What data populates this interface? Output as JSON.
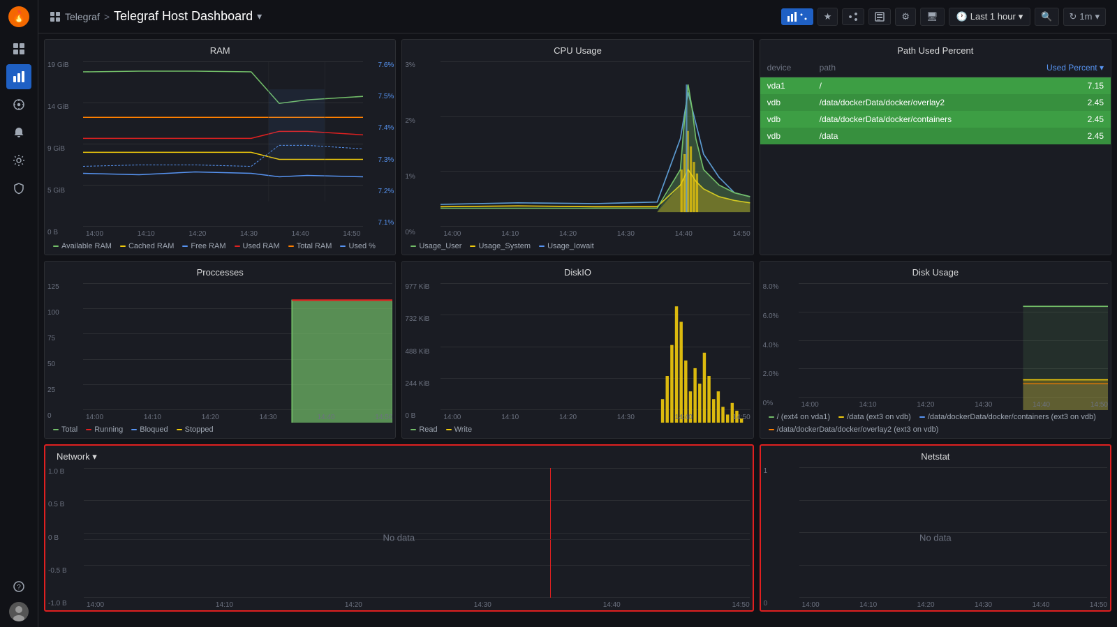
{
  "app": {
    "logo": "🔥",
    "breadcrumb_app": "Telegraf",
    "breadcrumb_sep": ">",
    "dashboard_title": "Telegraf Host Dashboard",
    "dropdown_arrow": "▾"
  },
  "topbar": {
    "buttons": [
      {
        "label": "⬤⬤",
        "name": "chart-btn",
        "active": true
      },
      {
        "label": "★",
        "name": "star-btn"
      },
      {
        "label": "⇗",
        "name": "share-btn"
      },
      {
        "label": "⬚",
        "name": "library-btn"
      },
      {
        "label": "⚙",
        "name": "settings-btn"
      },
      {
        "label": "🖥",
        "name": "display-btn"
      }
    ],
    "time_range": "Last 1 hour",
    "search_icon": "🔍",
    "refresh_icon": "↻",
    "refresh_interval": "1m"
  },
  "sidebar": {
    "icons": [
      {
        "name": "grid-icon",
        "glyph": "⊞",
        "active": false
      },
      {
        "name": "compass-icon",
        "glyph": "⊕",
        "active": false
      },
      {
        "name": "apps-icon",
        "glyph": "⚏",
        "active": true
      },
      {
        "name": "alert-icon",
        "glyph": "🔔",
        "active": false
      },
      {
        "name": "gear-icon",
        "glyph": "⚙",
        "active": false
      },
      {
        "name": "shield-icon",
        "glyph": "🛡",
        "active": false
      }
    ]
  },
  "panels": {
    "ram": {
      "title": "RAM",
      "y_labels": [
        "19 GiB",
        "14 GiB",
        "9 GiB",
        "5 GiB",
        "0 B"
      ],
      "y2_labels": [
        "7.6%",
        "7.5%",
        "7.4%",
        "7.3%",
        "7.2%",
        "7.1%"
      ],
      "x_labels": [
        "14:00",
        "14:10",
        "14:20",
        "14:30",
        "14:40",
        "14:50"
      ],
      "legend": [
        {
          "label": "Available RAM",
          "color": "#73bf69"
        },
        {
          "label": "Cached RAM",
          "color": "#f2cc0c"
        },
        {
          "label": "Free RAM",
          "color": "#5794f2"
        },
        {
          "label": "Used RAM",
          "color": "#e02020"
        },
        {
          "label": "Total RAM",
          "color": "#ff7f00"
        },
        {
          "label": "Used %",
          "color": "#5794f2"
        }
      ]
    },
    "cpu": {
      "title": "CPU Usage",
      "y_labels": [
        "3%",
        "2%",
        "1%",
        "0%"
      ],
      "x_labels": [
        "14:00",
        "14:10",
        "14:20",
        "14:30",
        "14:40",
        "14:50"
      ],
      "legend": [
        {
          "label": "Usage_User",
          "color": "#73bf69"
        },
        {
          "label": "Usage_System",
          "color": "#f2cc0c"
        },
        {
          "label": "Usage_Iowait",
          "color": "#5794f2"
        }
      ]
    },
    "path_used_percent": {
      "title": "Path Used Percent",
      "columns": [
        "device",
        "path",
        "Used Percent"
      ],
      "rows": [
        {
          "device": "vda1",
          "path": "/",
          "value": "7.15"
        },
        {
          "device": "vdb",
          "path": "/data/dockerData/docker/overlay2",
          "value": "2.45"
        },
        {
          "device": "vdb",
          "path": "/data/dockerData/docker/containers",
          "value": "2.45"
        },
        {
          "device": "vdb",
          "path": "/data",
          "value": "2.45"
        }
      ]
    },
    "processes": {
      "title": "Proccesses",
      "y_labels": [
        "125",
        "100",
        "75",
        "50",
        "25",
        "0"
      ],
      "x_labels": [
        "14:00",
        "14:10",
        "14:20",
        "14:30",
        "14:40",
        "14:50"
      ],
      "legend": [
        {
          "label": "Total",
          "color": "#73bf69"
        },
        {
          "label": "Running",
          "color": "#e02020"
        },
        {
          "label": "Bloqued",
          "color": "#5794f2"
        },
        {
          "label": "Stopped",
          "color": "#f2cc0c"
        }
      ]
    },
    "diskio": {
      "title": "DiskIO",
      "y_labels": [
        "977 KiB",
        "732 KiB",
        "488 KiB",
        "244 KiB",
        "0 B"
      ],
      "x_labels": [
        "14:00",
        "14:10",
        "14:20",
        "14:30",
        "14:40",
        "14:50"
      ],
      "legend": [
        {
          "label": "Read",
          "color": "#73bf69"
        },
        {
          "label": "Write",
          "color": "#f2cc0c"
        }
      ]
    },
    "disk_usage": {
      "title": "Disk Usage",
      "y_labels": [
        "8.0%",
        "6.0%",
        "4.0%",
        "2.0%",
        "0%"
      ],
      "x_labels": [
        "14:00",
        "14:10",
        "14:20",
        "14:30",
        "14:40",
        "14:50"
      ],
      "legend": [
        {
          "label": "/ (ext4 on vda1)",
          "color": "#73bf69"
        },
        {
          "label": "/data (ext3 on vdb)",
          "color": "#f2cc0c"
        },
        {
          "label": "/data/dockerData/docker/containers (ext3 on vdb)",
          "color": "#5794f2"
        },
        {
          "label": "/data/dockerData/docker/overlay2 (ext3 on vdb)",
          "color": "#ff7f00"
        }
      ]
    },
    "network": {
      "title": "Network ▾",
      "y_labels": [
        "1.0 B",
        "0.5 B",
        "0 B",
        "-0.5 B",
        "-1.0 B"
      ],
      "x_labels": [
        "14:00",
        "14:10",
        "14:20",
        "14:30",
        "14:40",
        "14:50"
      ],
      "no_data": "No data",
      "highlighted": true
    },
    "netstat": {
      "title": "Netstat",
      "y_labels_top": [
        "1"
      ],
      "y_labels_bottom": [
        "0"
      ],
      "x_labels": [
        "14:00",
        "14:10",
        "14:20",
        "14:30",
        "14:40",
        "14:50"
      ],
      "no_data": "No data",
      "highlighted": true
    }
  }
}
